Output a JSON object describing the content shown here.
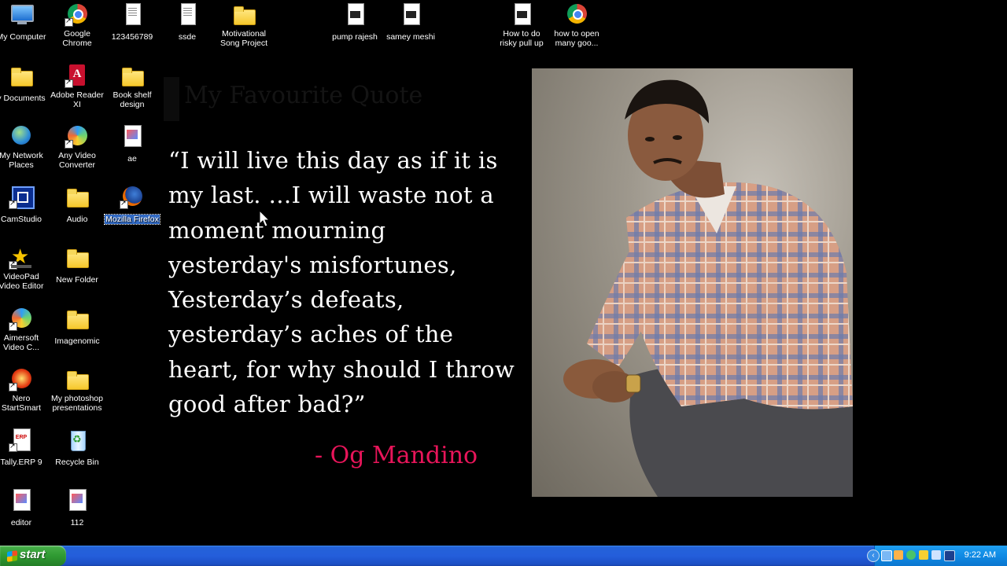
{
  "desktop": {
    "icons": [
      {
        "label": "My Computer"
      },
      {
        "label": "Google Chrome"
      },
      {
        "label": "123456789"
      },
      {
        "label": "ssde"
      },
      {
        "label": "Motivational Song Project"
      },
      {
        "label": "pump rajesh"
      },
      {
        "label": "samey meshi"
      },
      {
        "label": "How to do risky pull up"
      },
      {
        "label": "how to open many goo..."
      },
      {
        "label": "y Documents"
      },
      {
        "label": "Adobe Reader XI"
      },
      {
        "label": "Book shelf design"
      },
      {
        "label": "My Network Places"
      },
      {
        "label": "Any Video Converter"
      },
      {
        "label": "ae"
      },
      {
        "label": "CamStudio"
      },
      {
        "label": "Audio"
      },
      {
        "label": "Mozilla Firefox"
      },
      {
        "label": "VideoPad Video Editor"
      },
      {
        "label": "New Folder"
      },
      {
        "label": "Aimersoft Video C..."
      },
      {
        "label": "Imagenomic"
      },
      {
        "label": "Nero StartSmart"
      },
      {
        "label": "My photoshop presentations"
      },
      {
        "label": "Tally.ERP 9"
      },
      {
        "label": "Recycle Bin"
      },
      {
        "label": "editor"
      },
      {
        "label": "112"
      }
    ],
    "selected_icon": "Mozilla Firefox"
  },
  "slide": {
    "faded_title": "My Favourite Quote",
    "quote": "“I will live this day as if it is my last. …I will waste not a moment mourning yesterday's misfortunes, Yesterday’s defeats, yesterday’s aches of the heart, for why should I throw good after bad?”",
    "author": "- Og Mandino",
    "author_color": "#e8155a"
  },
  "taskbar": {
    "start_label": "start",
    "clock": "9:22 AM",
    "colors": {
      "bar": "#245edb",
      "start": "#2f9a32",
      "tray": "#0f8ae4"
    }
  }
}
